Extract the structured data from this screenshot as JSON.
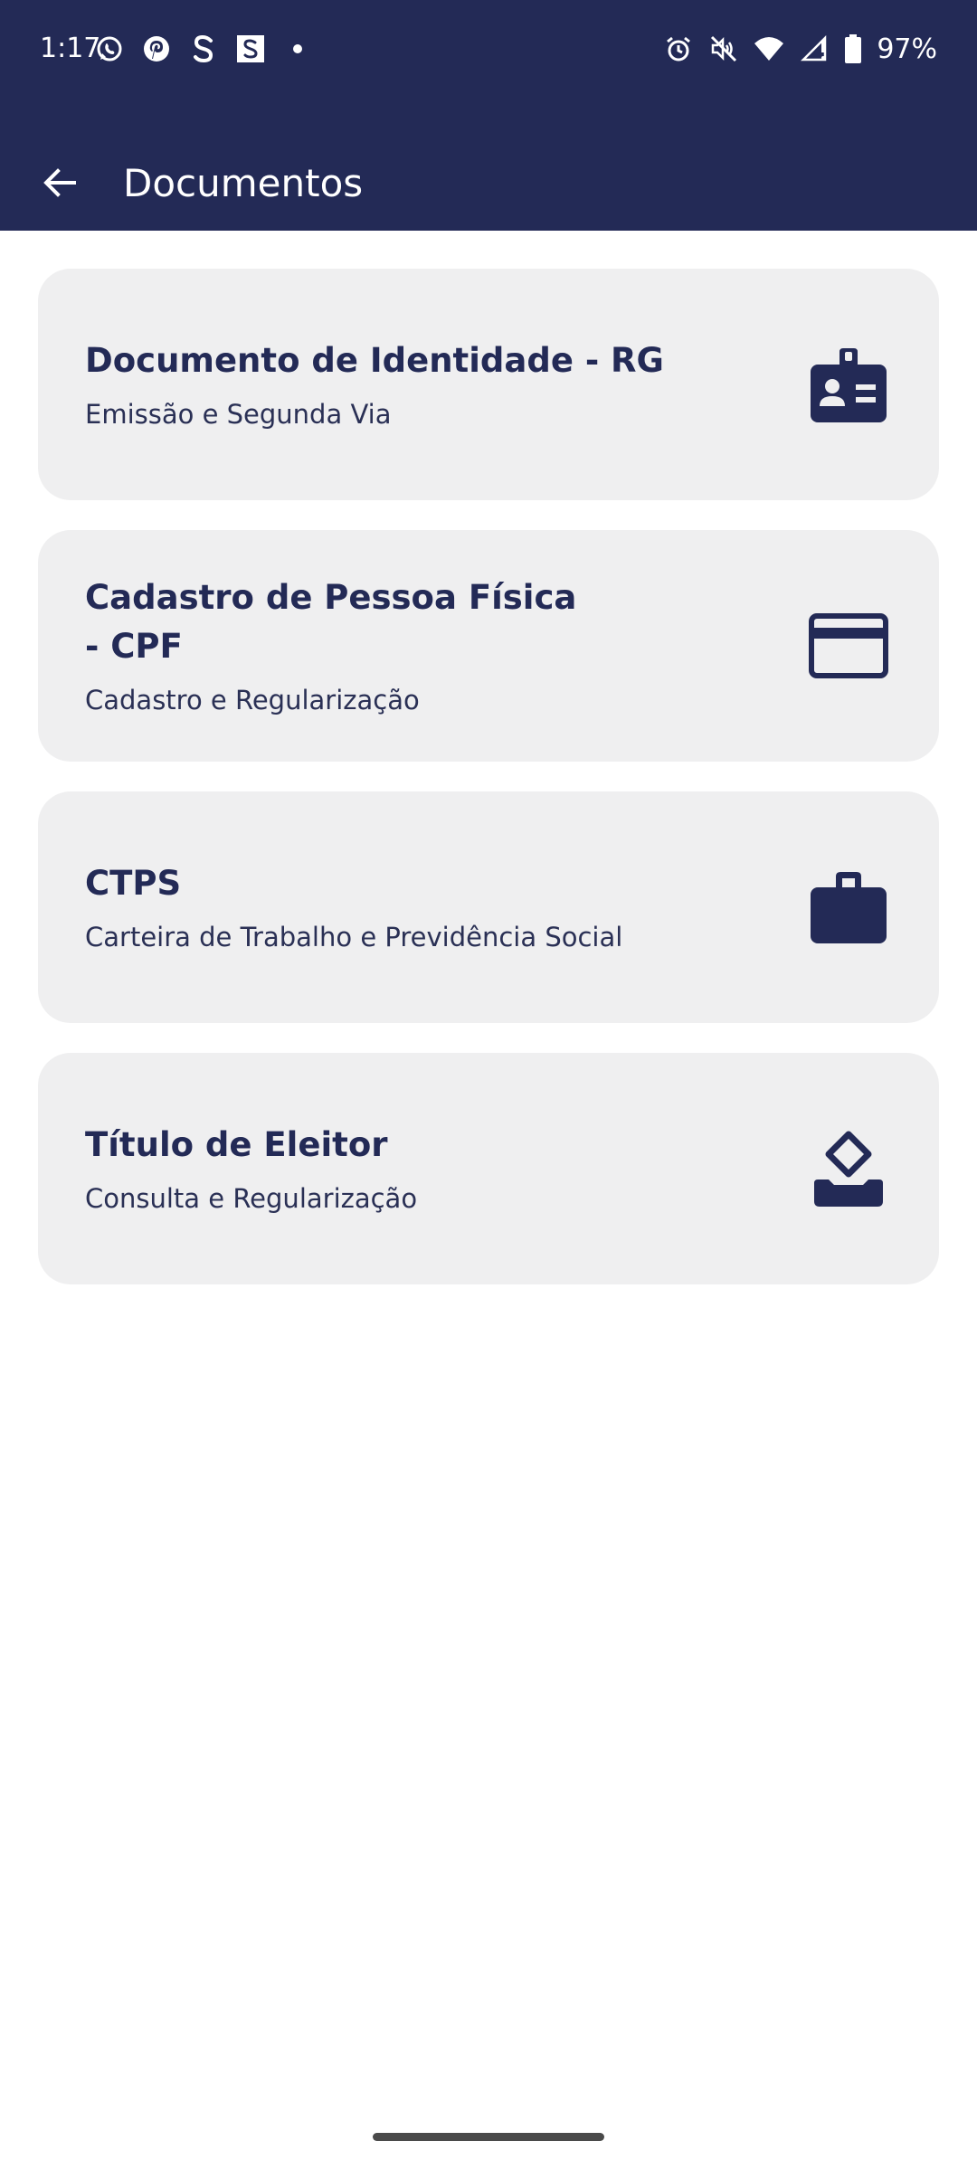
{
  "status_bar": {
    "time": "1:17",
    "left_icons": [
      "whatsapp-icon",
      "pinterest-icon",
      "s-app-icon",
      "s-box-icon",
      "dot-icon"
    ],
    "right_icons": [
      "alarm-icon",
      "mute-icon",
      "wifi-icon",
      "signal-icon",
      "battery-icon"
    ],
    "battery": "97%"
  },
  "app_bar": {
    "title": "Documentos",
    "back_icon": "arrow-back-icon"
  },
  "cards": [
    {
      "title": "Documento de Identidade - RG",
      "subtitle": "Emissão e Segunda Via",
      "icon": "id-badge-icon"
    },
    {
      "title": "Cadastro de Pessoa Física - CPF",
      "subtitle": "Cadastro e Regularização",
      "icon": "credit-card-icon"
    },
    {
      "title": "CTPS",
      "subtitle": "Carteira de Trabalho e Previdência Social",
      "icon": "briefcase-icon"
    },
    {
      "title": "Título de Eleitor",
      "subtitle": "Consulta e Regularização",
      "icon": "ballot-box-icon"
    }
  ],
  "colors": {
    "primary": "#232A56",
    "card_background": "#EFEFF0",
    "background": "#FFFFFF"
  }
}
